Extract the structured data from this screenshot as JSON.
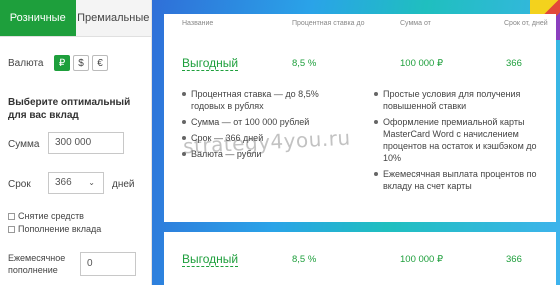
{
  "tabs": {
    "retail": "Розничные",
    "premium": "Премиальные"
  },
  "currency": {
    "label": "Валюта",
    "options": [
      "₽",
      "$",
      "€"
    ],
    "selected": "₽"
  },
  "choose_title": "Выберите оптимальный для вас вклад",
  "amount": {
    "label": "Сумма",
    "value": "300 000"
  },
  "term": {
    "label": "Срок",
    "value": "366",
    "unit": "дней"
  },
  "options": {
    "withdrawal": "Снятие средств",
    "topup": "Пополнение вклада"
  },
  "monthly": {
    "label": "Ежемесячное пополнение",
    "value": "0"
  },
  "table": {
    "headers": {
      "name": "Название",
      "rate": "Процентная ставка до",
      "amount": "Сумма от",
      "term": "Срок от, дней"
    },
    "deposits": [
      {
        "name": "Выгодный",
        "rate": "8,5 %",
        "amount": "100 000 ₽",
        "term": "366",
        "features_left": [
          "Процентная ставка — до 8,5% годовых в рублях",
          "Сумма — от 100 000 рублей",
          "Срок — 366 дней",
          "Валюта — рубли"
        ],
        "features_right": [
          "Простые условия для получения повышенной ставки",
          "Оформление премиальной карты MasterCard Word с начислением процентов на остаток и кэшбэком до 10%",
          "Ежемесячная выплата процентов по вкладу на счет карты"
        ]
      },
      {
        "name": "Выгодный",
        "rate": "8,5 %",
        "amount": "100 000 ₽",
        "term": "366"
      }
    ]
  },
  "watermark": "strategy4you.ru",
  "colors": {
    "accent": "#1e9f3c",
    "backdrop": "#2aa3e8"
  }
}
